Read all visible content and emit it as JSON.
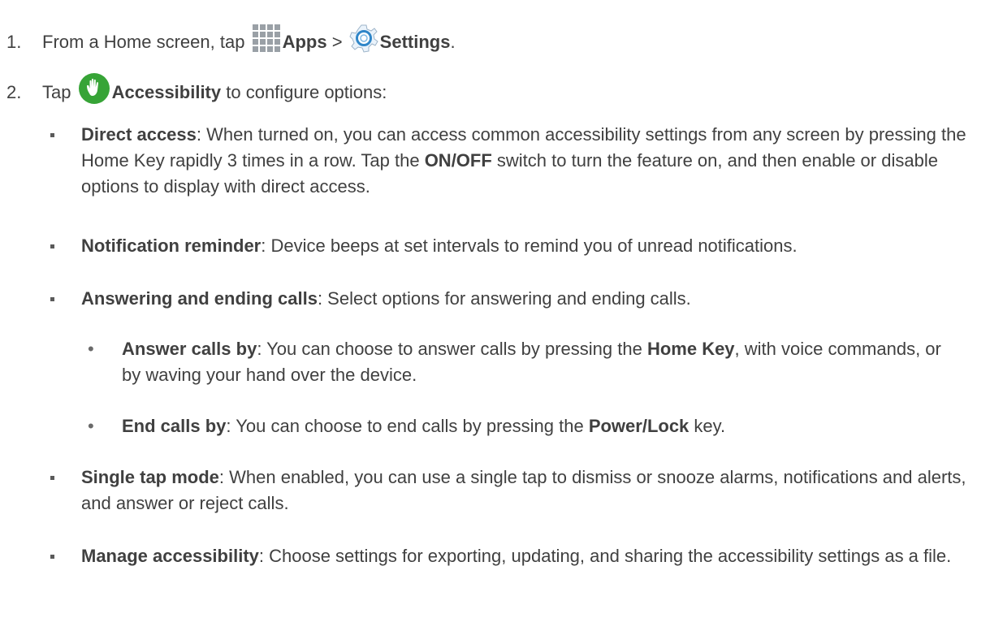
{
  "steps": {
    "step1": {
      "number": "1.",
      "prefix": "From a Home screen, tap",
      "apps_label": "Apps",
      "separator": ">",
      "settings_label": "Settings",
      "suffix": "."
    },
    "step2": {
      "number": "2.",
      "prefix": "Tap",
      "accessibility_label": "Accessibility",
      "suffix": "to configure options:"
    }
  },
  "options": {
    "direct_access": {
      "term": "Direct access",
      "text_1": ": When turned on, you can access common accessibility settings from any screen by pressing the Home Key rapidly 3 times in a row. Tap the ",
      "switch_label": "ON/OFF",
      "text_2": " switch to turn the feature on, and then enable or disable options to display with direct access."
    },
    "notification_reminder": {
      "term": "Notification reminder",
      "text": ": Device beeps at set intervals to remind you of unread notifications."
    },
    "answering_ending": {
      "term": "Answering and ending calls",
      "text": ": Select options for answering and ending calls."
    },
    "answer_calls_by": {
      "bullet": "•",
      "term": "Answer calls by",
      "text_1": ": You can choose to answer calls by pressing the ",
      "key": "Home Key",
      "text_2": ", with voice commands, or by waving your hand over the device."
    },
    "end_calls_by": {
      "bullet": "•",
      "term": "End calls by",
      "text_1": ": You can choose to end calls by pressing the ",
      "key": "Power/Lock",
      "text_2": " key."
    },
    "single_tap": {
      "term": "Single tap mode",
      "text": ": When enabled, you can use a single tap to dismiss or snooze alarms, notifications and alerts, and answer or reject calls."
    },
    "manage_accessibility": {
      "term": "Manage accessibility",
      "text": ": Choose settings for exporting, updating, and sharing the accessibility settings as a file."
    }
  },
  "icons": {
    "apps": "apps-grid-icon",
    "settings": "settings-gear-icon",
    "accessibility": "accessibility-hand-icon"
  },
  "colors": {
    "text": "#404040",
    "apps_icon": "#9aa0a6",
    "settings_icon": "#2f86c8",
    "accessibility_icon": "#37a437"
  }
}
